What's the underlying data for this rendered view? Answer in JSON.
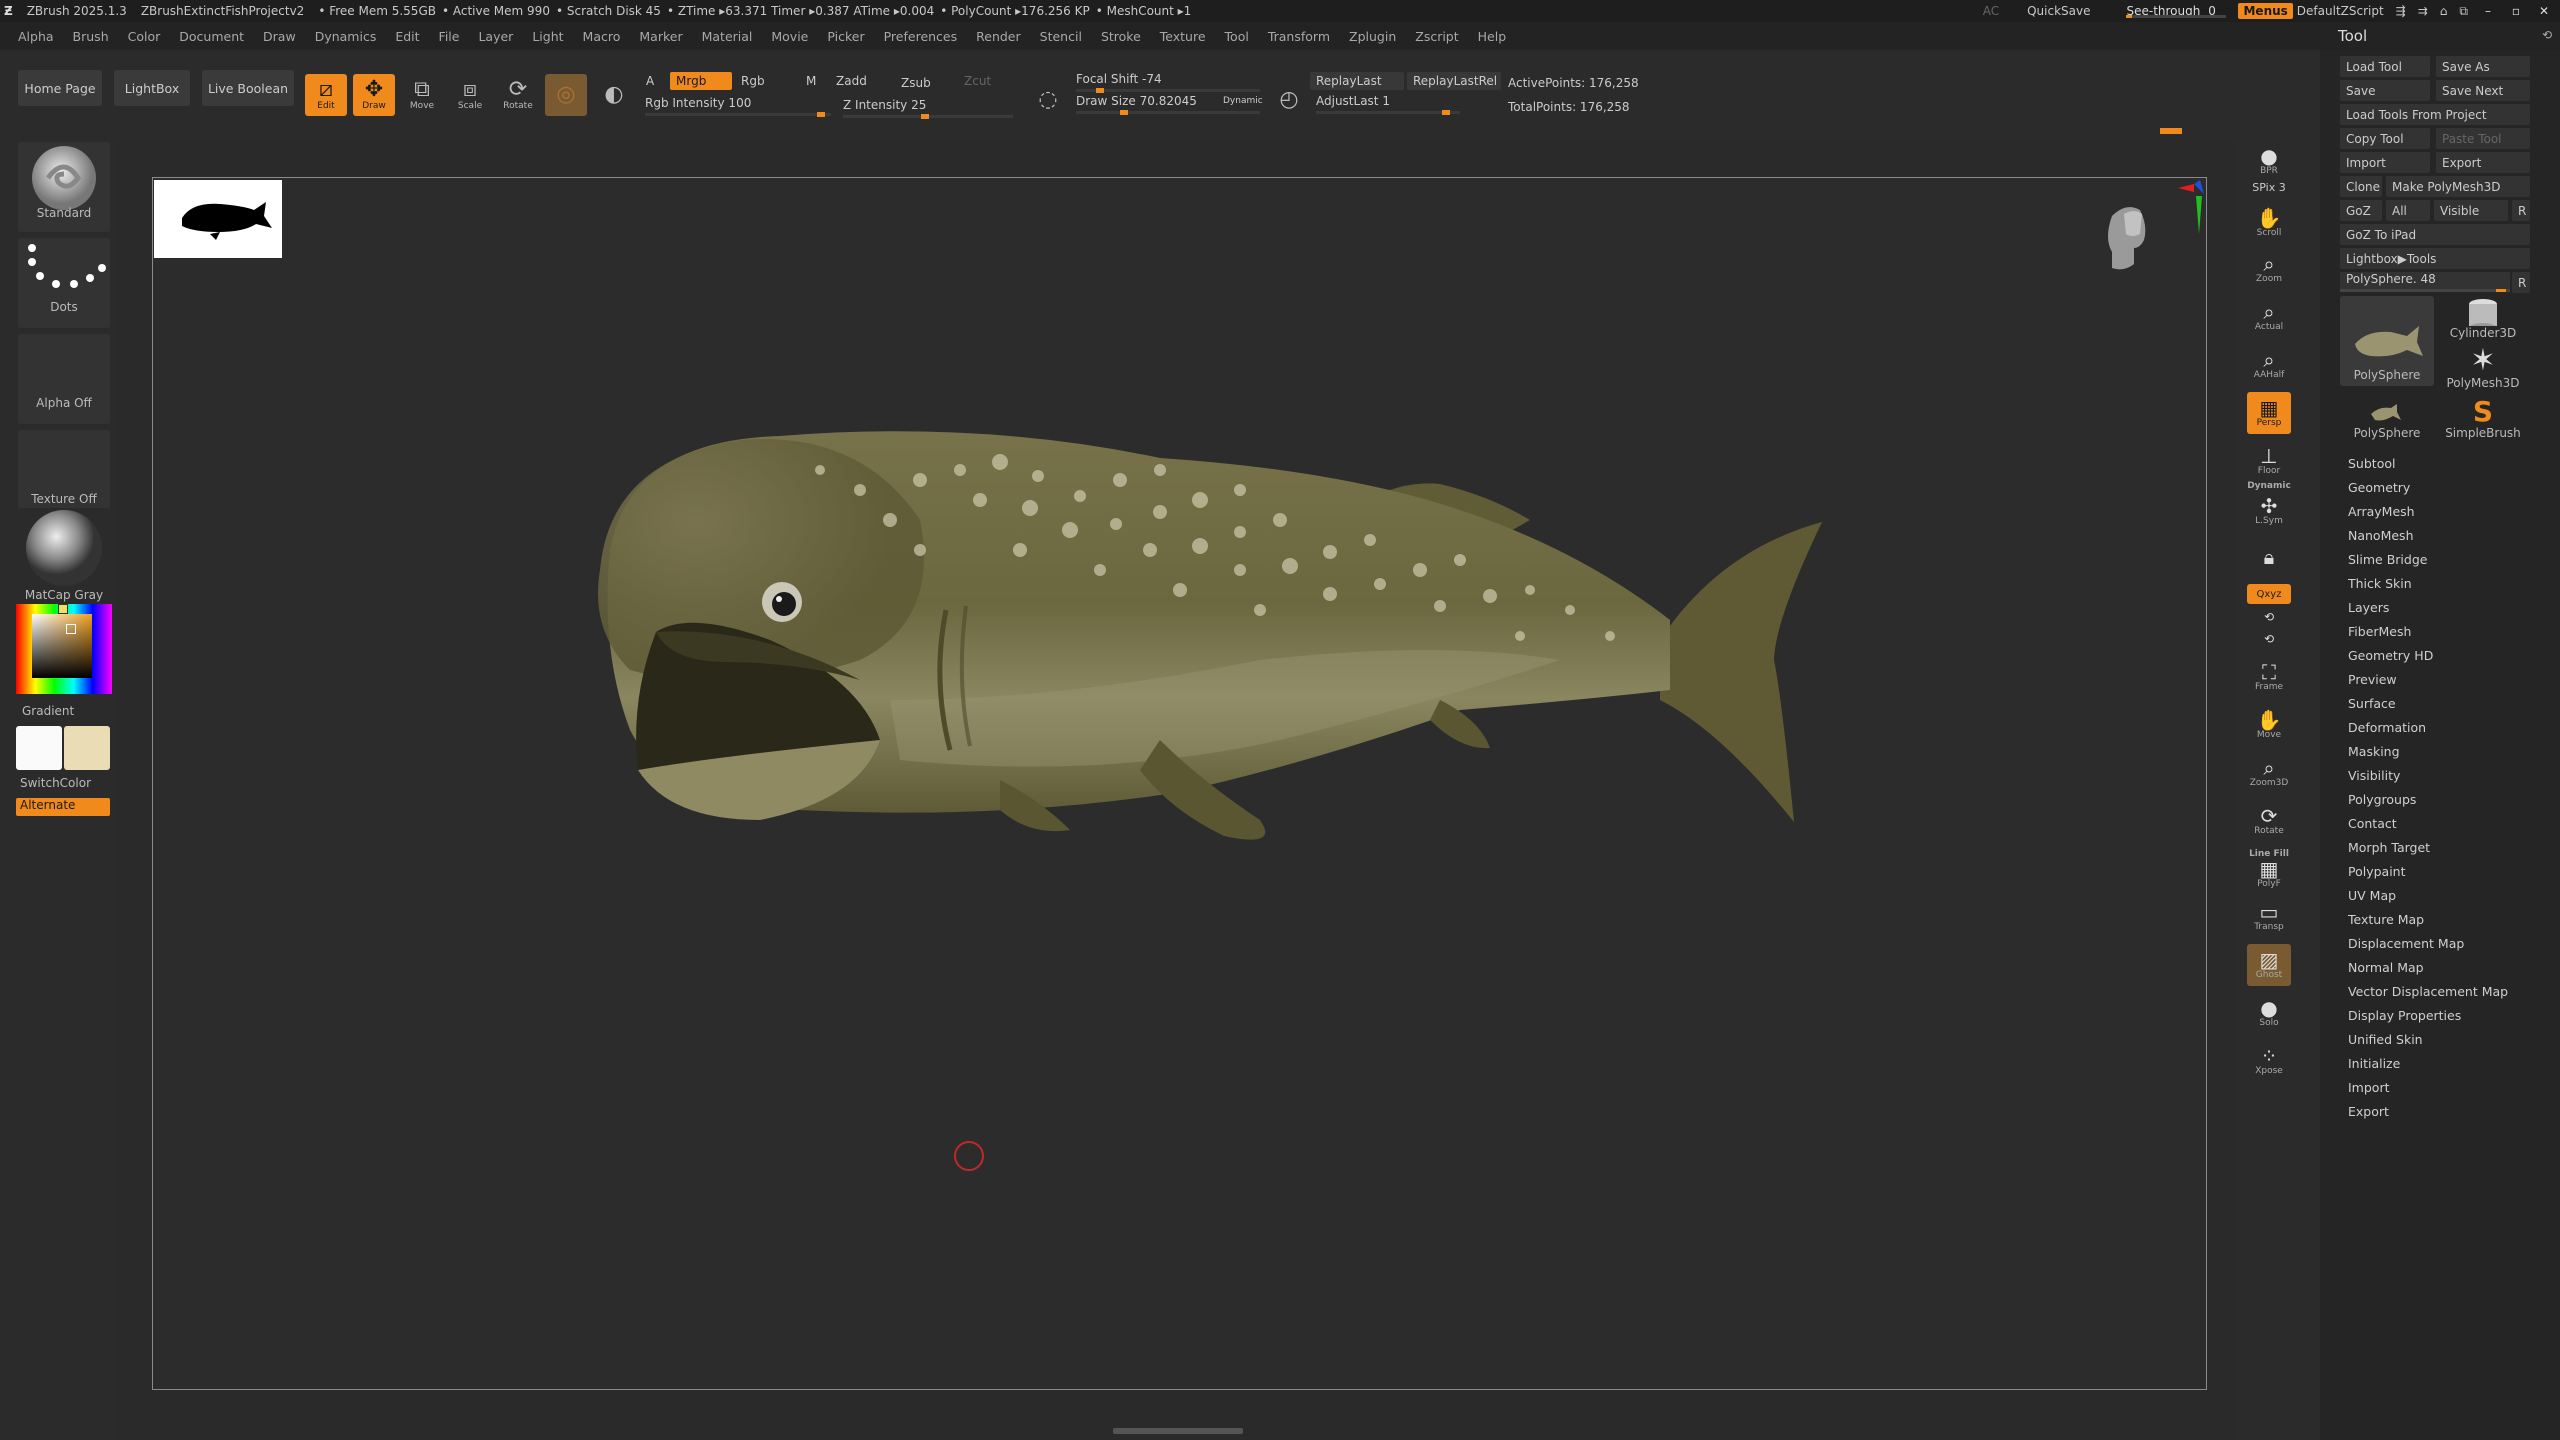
{
  "titlebar": {
    "app": "ZBrush 2025.1.3",
    "project": "ZBrushExtinctFishProjectv2",
    "free_mem": "• Free Mem 5.55GB",
    "active_mem": "• Active Mem 990",
    "scratch_disk": "• Scratch Disk 45",
    "ztime": "• ZTime ▸63.371 Timer ▸0.387 ATime ▸0.004",
    "polycount": "• PolyCount ▸176.256 KP",
    "meshcount": "• MeshCount ▸1",
    "ac": "AC",
    "quicksave": "QuickSave",
    "see_through_label": "See-through",
    "see_through_value": "0",
    "menus": "Menus",
    "default_script": "DefaultZScript"
  },
  "menubar": [
    "Alpha",
    "Brush",
    "Color",
    "Document",
    "Draw",
    "Dynamics",
    "Edit",
    "File",
    "Layer",
    "Light",
    "Macro",
    "Marker",
    "Material",
    "Movie",
    "Picker",
    "Preferences",
    "Render",
    "Stencil",
    "Stroke",
    "Texture",
    "Tool",
    "Transform",
    "Zplugin",
    "Zscript",
    "Help"
  ],
  "toolbar": {
    "home_page": "Home Page",
    "lightbox": "LightBox",
    "live_boolean": "Live Boolean",
    "edit": "Edit",
    "draw": "Draw",
    "move": "Move",
    "scale": "Scale",
    "rotate": "Rotate",
    "a_label": "A",
    "mrgb": "Mrgb",
    "rgb": "Rgb",
    "m": "M",
    "zadd": "Zadd",
    "zsub": "Zsub",
    "zcut": "Zcut",
    "rgb_intensity": "Rgb Intensity 100",
    "z_intensity": "Z Intensity 25",
    "focal_shift": "Focal Shift -74",
    "draw_size": "Draw Size 70.82045",
    "dynamic": "Dynamic",
    "replay_last": "ReplayLast",
    "replay_last_rel": "ReplayLastRel",
    "adjust_last": "AdjustLast 1",
    "active_points": "ActivePoints: 176,258",
    "total_points": "TotalPoints: 176,258"
  },
  "leftshelf": {
    "brush": "Standard",
    "stroke": "Dots",
    "alpha": "Alpha Off",
    "texture": "Texture Off",
    "material": "MatCap Gray",
    "gradient": "Gradient",
    "switchcolor": "SwitchColor",
    "alternate": "Alternate"
  },
  "rightshelf": [
    {
      "name": "bpr",
      "label": "BPR"
    },
    {
      "name": "spix",
      "label": "SPix 3"
    },
    {
      "name": "scroll",
      "label": "Scroll"
    },
    {
      "name": "zoom",
      "label": "Zoom"
    },
    {
      "name": "actual",
      "label": "Actual"
    },
    {
      "name": "aahalf",
      "label": "AAHalf"
    },
    {
      "name": "persp",
      "label": "Persp"
    },
    {
      "name": "floor",
      "label": "Floor"
    },
    {
      "name": "dynamic",
      "label": "Dynamic"
    },
    {
      "name": "lsym",
      "label": "L.Sym"
    },
    {
      "name": "xyz",
      "label": "Qxyz"
    },
    {
      "name": "frame",
      "label": "Frame"
    },
    {
      "name": "move",
      "label": "Move"
    },
    {
      "name": "zoom3d",
      "label": "Zoom3D"
    },
    {
      "name": "rotate",
      "label": "Rotate"
    },
    {
      "name": "linefill",
      "label": "Line Fill"
    },
    {
      "name": "polyf",
      "label": "PolyF"
    },
    {
      "name": "transp",
      "label": "Transp"
    },
    {
      "name": "ghost",
      "label": "Ghost"
    },
    {
      "name": "solo",
      "label": "Solo"
    },
    {
      "name": "xpose",
      "label": "Xpose"
    }
  ],
  "toolpanel": {
    "title": "Tool",
    "load_tool": "Load Tool",
    "save_as": "Save As",
    "save": "Save",
    "save_next": "Save Next",
    "load_from_project": "Load Tools From Project",
    "copy_tool": "Copy Tool",
    "paste_tool": "Paste Tool",
    "import": "Import",
    "export": "Export",
    "clone": "Clone",
    "make_polymesh": "Make PolyMesh3D",
    "goz": "GoZ",
    "all": "All",
    "visible": "Visible",
    "r": "R",
    "goz_ipad": "GoZ To iPad",
    "lightbox_tools": "Lightbox▶Tools",
    "polysphere_slider": "PolySphere. 48",
    "tiles": [
      {
        "label": "PolySphere",
        "kind": "fish"
      },
      {
        "label": "Cylinder3D",
        "kind": "cylinder"
      },
      {
        "label": "PolyMesh3D",
        "kind": "star"
      },
      {
        "label": "PolySphere",
        "kind": "fish-small"
      },
      {
        "label": "SimpleBrush",
        "kind": "s"
      }
    ],
    "subpalettes": [
      "Subtool",
      "Geometry",
      "ArrayMesh",
      "NanoMesh",
      "Slime Bridge",
      "Thick Skin",
      "Layers",
      "FiberMesh",
      "Geometry HD",
      "Preview",
      "Surface",
      "Deformation",
      "Masking",
      "Visibility",
      "Polygroups",
      "Contact",
      "Morph Target",
      "Polypaint",
      "UV Map",
      "Texture Map",
      "Displacement Map",
      "Normal Map",
      "Vector Displacement Map",
      "Display Properties",
      "Unified Skin",
      "Initialize",
      "Import",
      "Export"
    ]
  },
  "colors": {
    "accent": "#f08a1c",
    "fish_body": "#6b6840",
    "fish_belly": "#8c8a63",
    "background": "#262626"
  }
}
